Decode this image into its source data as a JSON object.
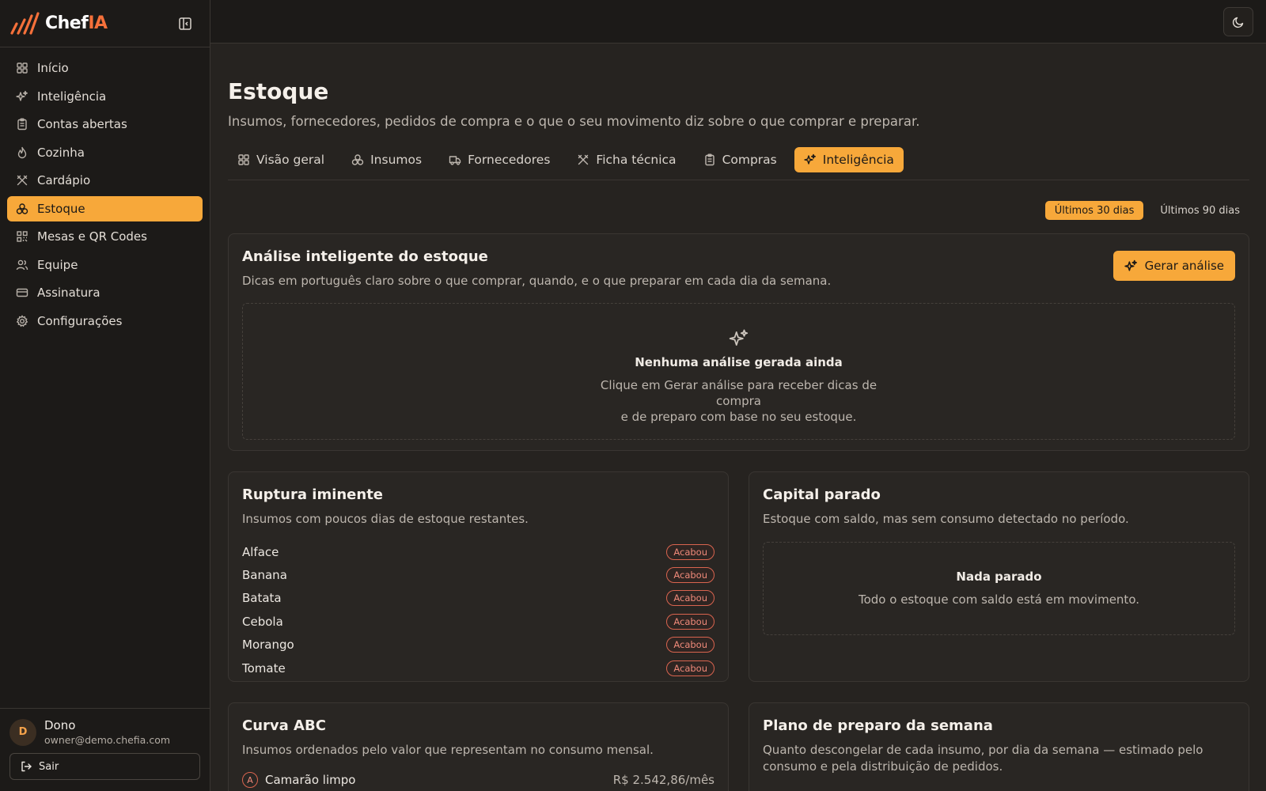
{
  "brand": {
    "name_main": "Chef",
    "name_accent": "IA"
  },
  "sidebar": {
    "items": [
      {
        "label": "Início",
        "icon": "grid-icon"
      },
      {
        "label": "Inteligência",
        "icon": "sparkles-icon"
      },
      {
        "label": "Contas abertas",
        "icon": "clipboard-icon"
      },
      {
        "label": "Cozinha",
        "icon": "flame-icon"
      },
      {
        "label": "Cardápio",
        "icon": "utensils-icon"
      },
      {
        "label": "Estoque",
        "icon": "boxes-icon",
        "active": true
      },
      {
        "label": "Mesas e QR Codes",
        "icon": "qr-icon"
      },
      {
        "label": "Equipe",
        "icon": "users-icon"
      },
      {
        "label": "Assinatura",
        "icon": "card-icon"
      },
      {
        "label": "Configurações",
        "icon": "gear-icon"
      }
    ]
  },
  "user": {
    "initial": "D",
    "name": "Dono",
    "email": "owner@demo.chefia.com",
    "logout_label": "Sair"
  },
  "page": {
    "title": "Estoque",
    "subtitle": "Insumos, fornecedores, pedidos de compra e o que o seu movimento diz sobre o que comprar e preparar."
  },
  "tabs": [
    {
      "label": "Visão geral",
      "icon": "grid-icon"
    },
    {
      "label": "Insumos",
      "icon": "boxes-icon"
    },
    {
      "label": "Fornecedores",
      "icon": "truck-icon"
    },
    {
      "label": "Ficha técnica",
      "icon": "utensils-icon"
    },
    {
      "label": "Compras",
      "icon": "clipboard-icon"
    },
    {
      "label": "Inteligência",
      "icon": "sparkles-icon",
      "active": true
    }
  ],
  "period": {
    "option_30": "Últimos 30 dias",
    "option_90": "Últimos 90 dias",
    "selected": "Últimos 30 dias"
  },
  "analysis": {
    "title": "Análise inteligente do estoque",
    "description": "Dicas em português claro sobre o que comprar, quando, e o que preparar em cada dia da semana.",
    "button_label": "Gerar análise",
    "empty_title": "Nenhuma análise gerada ainda",
    "empty_text_line1": "Clique em Gerar análise para receber dicas de compra",
    "empty_text_line2": "e de preparo com base no seu estoque."
  },
  "rupture": {
    "title": "Ruptura iminente",
    "description": "Insumos com poucos dias de estoque restantes.",
    "items": [
      {
        "name": "Alface",
        "status": "Acabou"
      },
      {
        "name": "Banana",
        "status": "Acabou"
      },
      {
        "name": "Batata",
        "status": "Acabou"
      },
      {
        "name": "Cebola",
        "status": "Acabou"
      },
      {
        "name": "Morango",
        "status": "Acabou"
      },
      {
        "name": "Tomate",
        "status": "Acabou"
      }
    ]
  },
  "capital": {
    "title": "Capital parado",
    "description": "Estoque com saldo, mas sem consumo detectado no período.",
    "empty_title": "Nada parado",
    "empty_text": "Todo o estoque com saldo está em movimento."
  },
  "abc": {
    "title": "Curva ABC",
    "description": "Insumos ordenados pelo valor que representam no consumo mensal.",
    "first_item": {
      "class": "A",
      "name": "Camarão limpo",
      "value": "R$ 2.542,86/mês"
    }
  },
  "plan": {
    "title": "Plano de preparo da semana",
    "description": "Quanto descongelar de cada insumo, por dia da semana — estimado pelo consumo e pela distribuição de pedidos."
  },
  "colors": {
    "accent": "#f7a83a",
    "brand_accent": "#f5703a",
    "danger": "#f08a7a",
    "background": "#262320",
    "sidebar": "#1c1a18"
  }
}
